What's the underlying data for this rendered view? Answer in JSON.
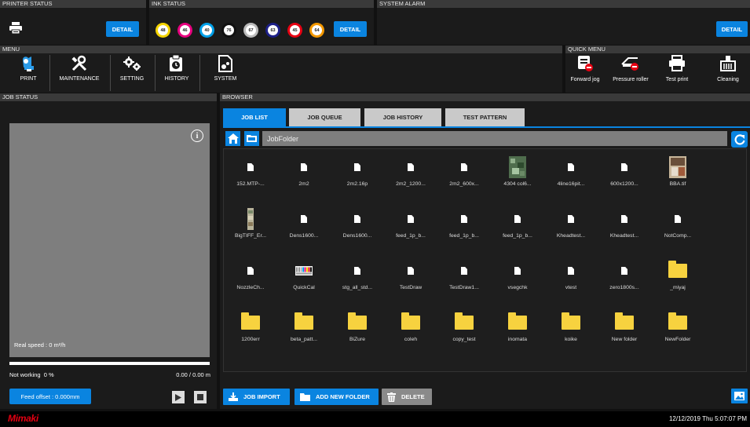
{
  "header": {
    "printer_status": "PRINTER STATUS",
    "ink_status": "INK STATUS",
    "system_alarm": "SYSTEM ALARM",
    "detail_label": "DETAIL",
    "inks": [
      {
        "label": "48",
        "color": "#f5d400"
      },
      {
        "label": "46",
        "color": "#e6007e"
      },
      {
        "label": "40",
        "color": "#00a0e9"
      },
      {
        "label": "76",
        "color": "#111111"
      },
      {
        "label": "67",
        "color": "#bbbbbb"
      },
      {
        "label": "63",
        "color": "#1d2088"
      },
      {
        "label": "45",
        "color": "#e60012"
      },
      {
        "label": "64",
        "color": "#f39800"
      }
    ]
  },
  "menu": {
    "title": "MENU",
    "items": [
      {
        "label": "PRINT",
        "icon": "print-icon"
      },
      {
        "label": "MAINTENANCE",
        "icon": "tools-icon"
      },
      {
        "label": "SETTING",
        "icon": "gears-icon"
      },
      {
        "label": "HISTORY",
        "icon": "history-icon"
      },
      {
        "label": "SYSTEM",
        "icon": "system-icon"
      }
    ]
  },
  "quick_menu": {
    "title": "QUICK MENU",
    "items": [
      {
        "label": "Forward jog",
        "icon": "forward-jog-icon"
      },
      {
        "label": "Pressure roller",
        "icon": "pressure-roller-icon"
      },
      {
        "label": "Test print",
        "icon": "printer-icon"
      },
      {
        "label": "Cleaning",
        "icon": "cleaning-icon"
      }
    ]
  },
  "job_status": {
    "title": "JOB STATUS",
    "real_speed": "Real speed : 0 m²/h",
    "state": "Not working",
    "percent": "0 %",
    "progress": 0,
    "length": "0.00 / 0.00 m",
    "feed_offset": "Feed offset : 0.000mm"
  },
  "browser": {
    "title": "BROWSER",
    "tabs": [
      "JOB LIST",
      "JOB QUEUE",
      "JOB HISTORY",
      "TEST PATTERN"
    ],
    "active_tab": 0,
    "path": "JobFolder",
    "files": [
      {
        "name": "152.MTP-...",
        "type": "doc"
      },
      {
        "name": "2m2",
        "type": "doc"
      },
      {
        "name": "2m2.16p",
        "type": "doc"
      },
      {
        "name": "2m2_1200...",
        "type": "doc"
      },
      {
        "name": "2m2_600x...",
        "type": "doc"
      },
      {
        "name": "4304 col6...",
        "type": "thumb-green"
      },
      {
        "name": "4line16pit...",
        "type": "doc"
      },
      {
        "name": "600x1200...",
        "type": "doc"
      },
      {
        "name": "BBA.tif",
        "type": "thumb-photo"
      },
      {
        "name": "BigTIFF_Er...",
        "type": "thumb-tall"
      },
      {
        "name": "Dens1600...",
        "type": "doc"
      },
      {
        "name": "Dens1600...",
        "type": "doc"
      },
      {
        "name": "feed_1p_b...",
        "type": "doc"
      },
      {
        "name": "feed_1p_b...",
        "type": "doc"
      },
      {
        "name": "feed_1p_b...",
        "type": "doc"
      },
      {
        "name": "Kheadtest...",
        "type": "doc"
      },
      {
        "name": "Kheadtest...",
        "type": "doc"
      },
      {
        "name": "NotComp...",
        "type": "doc"
      },
      {
        "name": "NozzleCh...",
        "type": "doc"
      },
      {
        "name": "QuickCal",
        "type": "thumb-cal"
      },
      {
        "name": "stg_all_std...",
        "type": "doc"
      },
      {
        "name": "TestDraw",
        "type": "doc"
      },
      {
        "name": "TestDraw1...",
        "type": "doc"
      },
      {
        "name": "vsegchk",
        "type": "doc"
      },
      {
        "name": "vtest",
        "type": "doc"
      },
      {
        "name": "zero1800s...",
        "type": "doc"
      },
      {
        "name": "_miyaj",
        "type": "folder"
      },
      {
        "name": "1200err",
        "type": "folder"
      },
      {
        "name": "beta_patt...",
        "type": "folder"
      },
      {
        "name": "BiZure",
        "type": "folder"
      },
      {
        "name": "coleh",
        "type": "folder"
      },
      {
        "name": "copy_test",
        "type": "folder"
      },
      {
        "name": "inomata",
        "type": "folder"
      },
      {
        "name": "koike",
        "type": "folder"
      },
      {
        "name": "New folder",
        "type": "folder"
      },
      {
        "name": "NewFolder",
        "type": "folder"
      }
    ],
    "actions": {
      "import": "JOB IMPORT",
      "new_folder": "ADD NEW FOLDER",
      "delete": "DELETE"
    }
  },
  "footer": {
    "brand": "Mimaki",
    "datetime": "12/12/2019 Thu 5:07:07 PM"
  },
  "colors": {
    "accent": "#0a84e0",
    "brand": "#e60012",
    "folder": "#f7d23f"
  }
}
